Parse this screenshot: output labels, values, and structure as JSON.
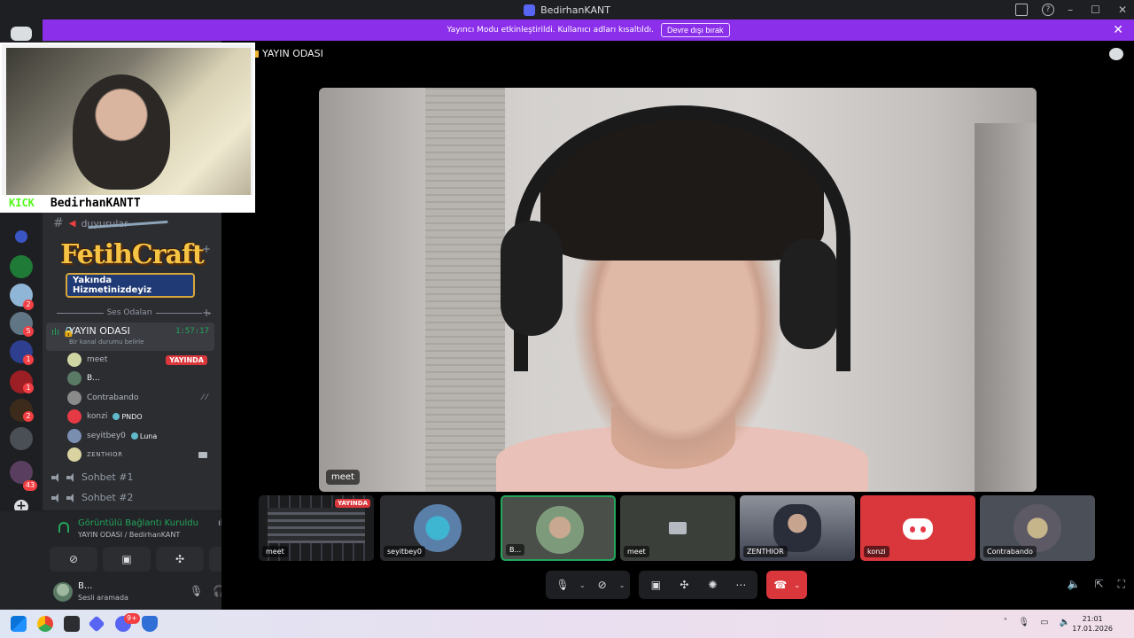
{
  "window": {
    "title": "BedirhanKANT"
  },
  "banner": {
    "message": "Yayıncı Modu etkinleştirildi. Kullanıcı adları kısaltıldı.",
    "button": "Devre dışı bırak"
  },
  "webcam_overlay": {
    "platform": "KICK",
    "name": "BedirhanKANTT"
  },
  "logo": {
    "title": "FetihCraft",
    "subtitle": "Yakında Hizmetinizdeyiz"
  },
  "sidebar": {
    "text_channel": "duyurular",
    "voice_section": "Ses Odaları",
    "voice_channel": {
      "name": "YAYIN ODASI",
      "timer": "1:57:17",
      "status": "Bir kanal durumu belirle"
    },
    "members": [
      {
        "name": "meet",
        "badge": "YAYINDA",
        "avatar_color": "#cfd6a3"
      },
      {
        "name": "B...",
        "avatar_color": "#5b7a66"
      },
      {
        "name": "Contrabando",
        "avatar_color": "#8a8a8a"
      },
      {
        "name": "konzi",
        "tag": "PNDO",
        "avatar_color": "#e63946"
      },
      {
        "name": "seyitbey0",
        "tag": "Luna",
        "avatar_color": "#7a8fb0"
      },
      {
        "name": "ZENTHIOR",
        "avatar_color": "#d9d3a2"
      }
    ],
    "other_channels": [
      "Sohbet #1",
      "Sohbet #2"
    ]
  },
  "voice_panel": {
    "status": "Görüntülü Bağlantı Kuruldu",
    "location": "YAYIN ODASI / BedirhanKANT"
  },
  "user": {
    "name": "B...",
    "status": "Sesli aramada"
  },
  "stage": {
    "channel": "YAYIN ODASI",
    "main_label": "meet",
    "tiles": [
      {
        "label": "meet",
        "live": "YAYINDA",
        "kind": "screen"
      },
      {
        "label": "seyitbey0",
        "kind": "avatar",
        "color": "#5a7fa8"
      },
      {
        "label": "B...",
        "kind": "avatar",
        "color": "#7d9b7a",
        "active": true
      },
      {
        "label": "meet",
        "kind": "camoff",
        "color": "#3a3f3a"
      },
      {
        "label": "ZENTHIOR",
        "kind": "cam",
        "color": "#6a6e78"
      },
      {
        "label": "konzi",
        "kind": "discord",
        "color": "#da373c"
      },
      {
        "label": "Contrabando",
        "kind": "avatar",
        "color": "#4b4f57"
      }
    ]
  },
  "rail": {
    "badges": [
      "2",
      "5",
      "1",
      "1",
      "2",
      "43"
    ]
  },
  "taskbar": {
    "time": "21:01",
    "date": "17.01.2026",
    "discord_badge": "9+"
  },
  "colors": {
    "banner": "#8b2fea",
    "accent_green": "#23a55a",
    "live_red": "#da373c",
    "blurple": "#5865f2"
  }
}
